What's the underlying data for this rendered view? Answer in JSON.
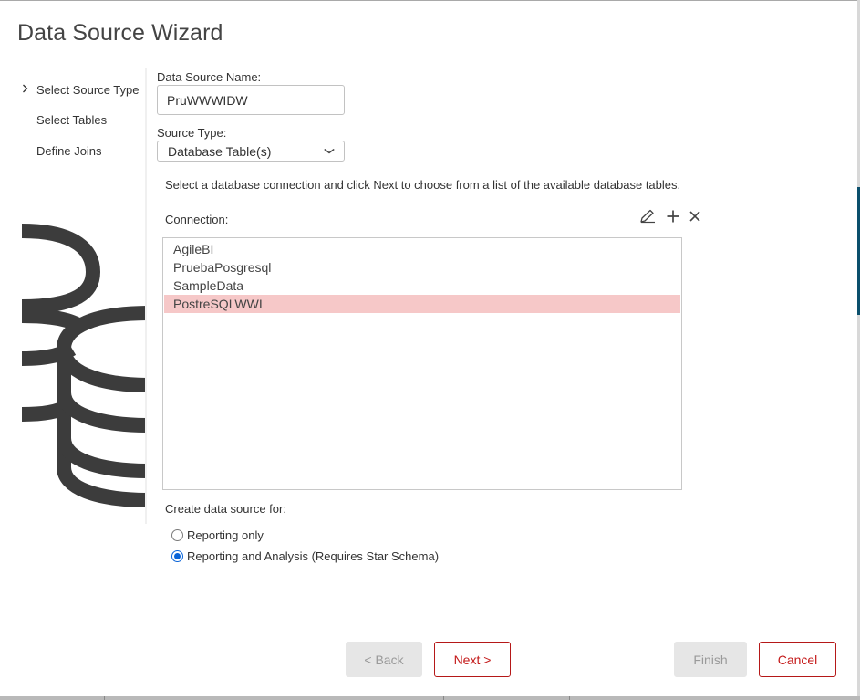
{
  "dialog": {
    "title": "Data Source Wizard"
  },
  "steps": [
    {
      "label": "Select Source Type",
      "current": true
    },
    {
      "label": "Select Tables",
      "current": false
    },
    {
      "label": "Define Joins",
      "current": false
    }
  ],
  "form": {
    "name_label": "Data Source Name:",
    "name_value": "PruWWWIDW",
    "type_label": "Source Type:",
    "type_value": "Database Table(s)",
    "instructions": "Select a database connection and click Next to choose from a list of the available database tables.",
    "connection_label": "Connection:",
    "connection_tools": [
      "pencil-icon",
      "plus-icon",
      "close-icon"
    ],
    "connections": [
      "AgileBI",
      "PruebaPosgresql",
      "SampleData",
      "PostreSQLWWI"
    ],
    "selected_connection": "PostreSQLWWI",
    "create_for_label": "Create data source for:",
    "create_options": [
      "Reporting only",
      "Reporting and Analysis (Requires Star Schema)"
    ],
    "create_selected": "Reporting and Analysis (Requires Star Schema)"
  },
  "buttons": {
    "back": "< Back",
    "next": "Next >",
    "finish": "Finish",
    "cancel": "Cancel"
  },
  "colors": {
    "accent": "#b51818",
    "selection": "#f6c8c8",
    "radio": "#0a64d8",
    "illustration": "#3c3c3c"
  }
}
